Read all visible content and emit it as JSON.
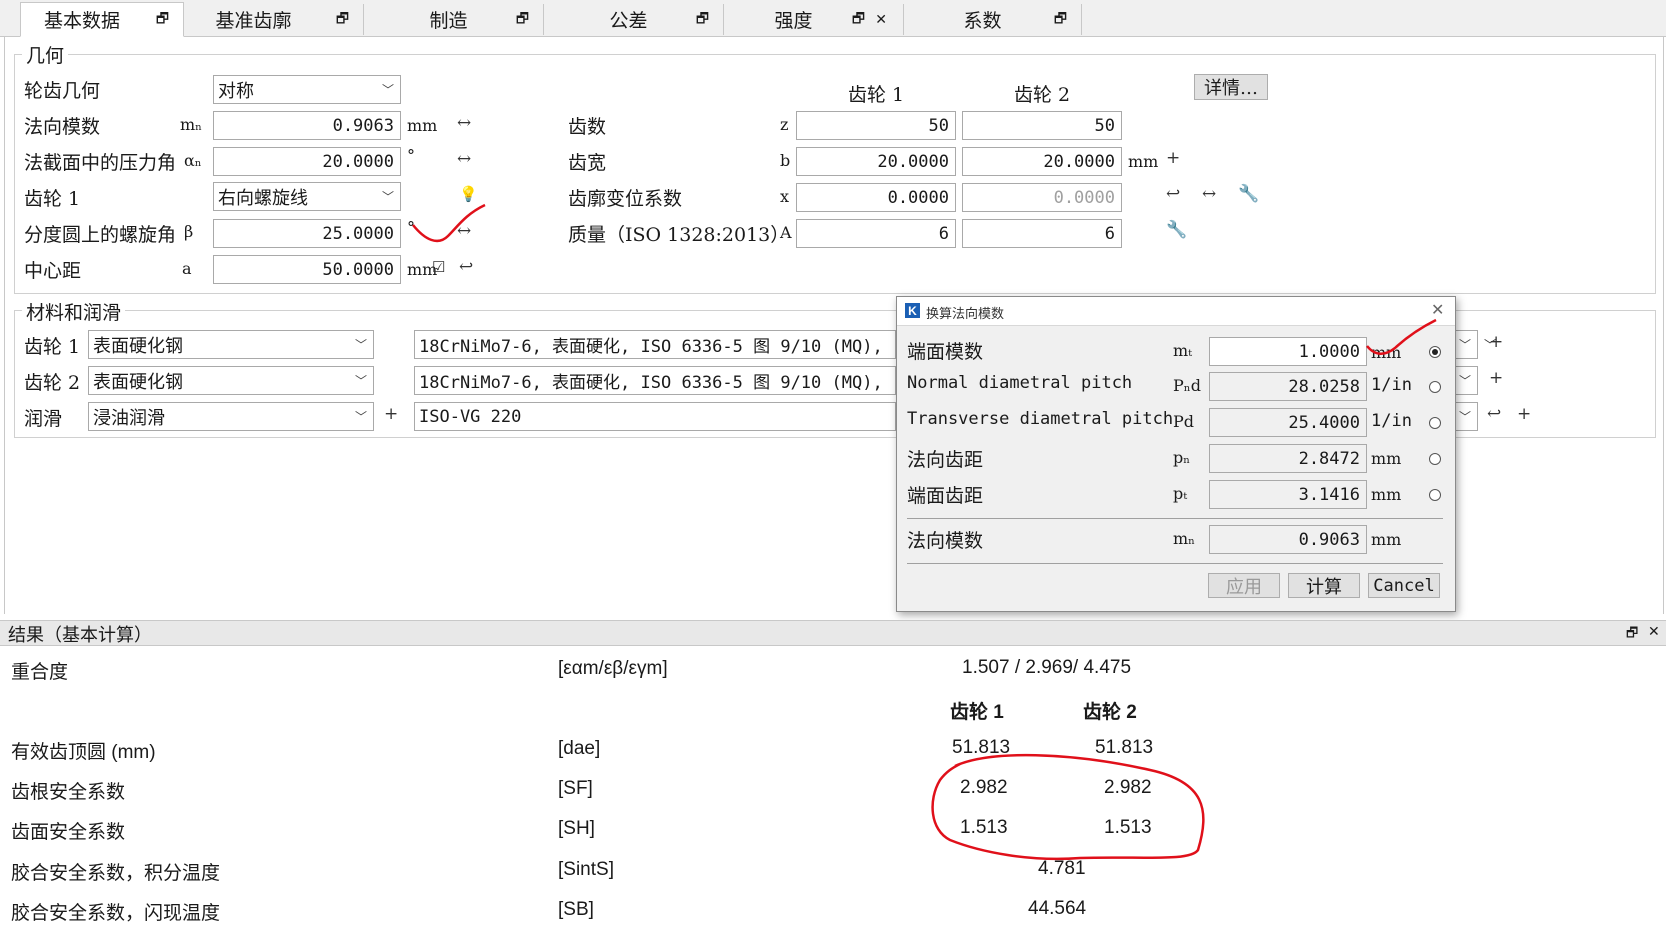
{
  "tabs": [
    {
      "label": "基本数据"
    },
    {
      "label": "基准齿廓"
    },
    {
      "label": "制造"
    },
    {
      "label": "公差"
    },
    {
      "label": "强度"
    },
    {
      "label": "系数"
    }
  ],
  "geometry": {
    "title": "几何",
    "tooth_geometry_label": "轮齿几何",
    "tooth_geometry_value": "对称",
    "normal_module_label": "法向模数",
    "normal_module_sym": "mₙ",
    "normal_module_value": "0.9063",
    "normal_module_unit": "mm",
    "pressure_angle_label": "法截面中的压力角",
    "pressure_angle_sym": "αₙ",
    "pressure_angle_value": "20.0000",
    "pressure_angle_unit": "°",
    "gear1_label": "齿轮 1",
    "gear1_value": "右向螺旋线",
    "helix_label": "分度圆上的螺旋角",
    "helix_sym": "β",
    "helix_value": "25.0000",
    "helix_unit": "°",
    "center_label": "中心距",
    "center_sym": "a",
    "center_value": "50.0000",
    "center_unit": "mm",
    "col_gear1": "齿轮 1",
    "col_gear2": "齿轮 2",
    "details_button": "详情…",
    "teeth_label": "齿数",
    "teeth_sym": "z",
    "teeth_g1": "50",
    "teeth_g2": "50",
    "width_label": "齿宽",
    "width_sym": "b",
    "width_g1": "20.0000",
    "width_g2": "20.0000",
    "width_unit": "mm",
    "shift_label": "齿廓变位系数",
    "shift_sym": "x",
    "shift_g1": "0.0000",
    "shift_g2": "0.0000",
    "quality_label": "质量（ISO 1328:2013）",
    "quality_sym": "A",
    "quality_g1": "6",
    "quality_g2": "6"
  },
  "material": {
    "title": "材料和润滑",
    "gear1_label": "齿轮 1",
    "gear1_type": "表面硬化钢",
    "gear1_material": "18CrNiMo7-6, 表面硬化, ISO 6336-5 图 9/10 (MQ),",
    "gear2_label": "齿轮 2",
    "gear2_type": "表面硬化钢",
    "gear2_material": "18CrNiMo7-6, 表面硬化, ISO 6336-5 图 9/10 (MQ),",
    "lube_label": "润滑",
    "lube_type": "浸油润滑",
    "lube_oil": "ISO-VG 220"
  },
  "dialog": {
    "title": "换算法向模数",
    "rows": [
      {
        "label": "端面模数",
        "sym": "mₜ",
        "value": "1.0000",
        "unit": "mm",
        "selected": true
      },
      {
        "label": "Normal diametral pitch",
        "sym": "Pₙd",
        "value": "28.0258",
        "unit": "1/in",
        "selected": false
      },
      {
        "label": "Transverse diametral pitch",
        "sym": "Pd",
        "value": "25.4000",
        "unit": "1/in",
        "selected": false
      },
      {
        "label": "法向齿距",
        "sym": "pₙ",
        "value": "2.8472",
        "unit": "mm",
        "selected": false
      },
      {
        "label": "端面齿距",
        "sym": "pₜ",
        "value": "3.1416",
        "unit": "mm",
        "selected": false
      }
    ],
    "result_label": "法向模数",
    "result_sym": "mₙ",
    "result_value": "0.9063",
    "result_unit": "mm",
    "apply": "应用",
    "calc": "计算",
    "cancel": "Cancel"
  },
  "results": {
    "header": "结果（基本计算）",
    "contact_ratio_label": "重合度",
    "contact_ratio_sym": "[εαm/εβ/εγm]",
    "contact_ratio_value": "1.507 /  2.969/ 4.475",
    "col_gear1": "齿轮 1",
    "col_gear2": "齿轮 2",
    "rows": [
      {
        "label": "有效齿顶圆 (mm)",
        "sym": "[dae]",
        "g1": "51.813",
        "g2": "51.813"
      },
      {
        "label": "齿根安全系数",
        "sym": "[SF]",
        "g1": "2.982",
        "g2": "2.982"
      },
      {
        "label": "齿面安全系数",
        "sym": "[SH]",
        "g1": "1.513",
        "g2": "1.513"
      }
    ],
    "scuff_int_label": "胶合安全系数，积分温度",
    "scuff_int_sym": "[SintS]",
    "scuff_int_value": "4.781",
    "scuff_flash_label": "胶合安全系数，闪现温度",
    "scuff_flash_sym": "[SB]",
    "scuff_flash_value": "44.564"
  },
  "colors": {
    "annotation": "#e0101a",
    "accent": "#1a5fb4"
  }
}
